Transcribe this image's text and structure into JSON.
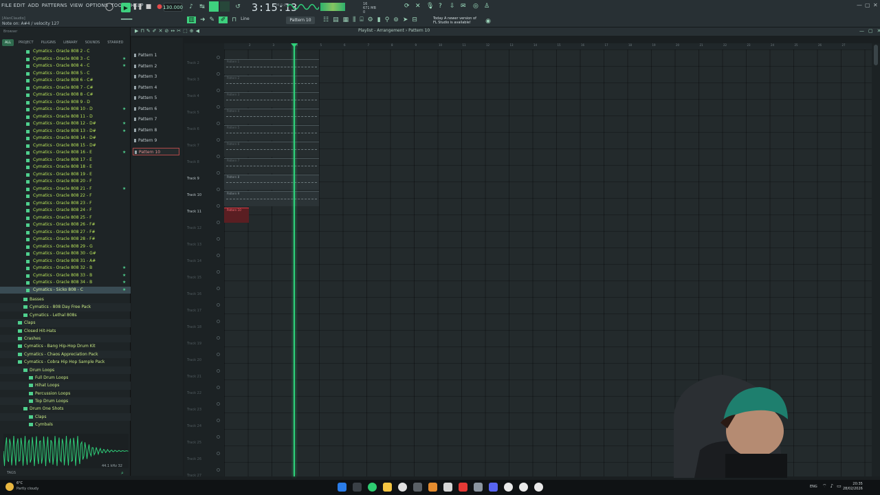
{
  "menu": [
    "FILE EDIT",
    "ADD",
    "PATTERNS",
    "VIEW",
    "OPTIONS",
    "TOOLS",
    "HELP"
  ],
  "hint": "[AlanClaudio]",
  "hint_line": "Note on: A#4 / velocity 127",
  "tempo": "130.000",
  "time": "3:15:13",
  "time_sub": "M:S:CS",
  "cpu_line1": "16",
  "cpu_line2": "671 MB",
  "cpu_line3": "0",
  "pattern_selector": "Pattern 10",
  "news_line1": "Today  A newer version of",
  "news_line2": "FL Studio is available!",
  "snap_mode": "Line",
  "playlist_title": "Playlist - Arrangement › Pattern 10",
  "browser": {
    "title": "Browser",
    "tabs": [
      "ALL",
      "PROJECT",
      "PLUGINS",
      "LIBRARY",
      "SOUNDS",
      "STARRED"
    ],
    "files": [
      {
        "name": "Cymatics - Oracle 808 2 - C",
        "star": false
      },
      {
        "name": "Cymatics - Oracle 808 3 - C",
        "star": true
      },
      {
        "name": "Cymatics - Oracle 808 4 - C",
        "star": true
      },
      {
        "name": "Cymatics - Oracle 808 5 - C",
        "star": false
      },
      {
        "name": "Cymatics - Oracle 808 6 - C#",
        "star": false
      },
      {
        "name": "Cymatics - Oracle 808 7 - C#",
        "star": false
      },
      {
        "name": "Cymatics - Oracle 808 8 - C#",
        "star": false
      },
      {
        "name": "Cymatics - Oracle 808 9 - D",
        "star": false
      },
      {
        "name": "Cymatics - Oracle 808 10 - D",
        "star": true
      },
      {
        "name": "Cymatics - Oracle 808 11 - D",
        "star": false
      },
      {
        "name": "Cymatics - Oracle 808 12 - D#",
        "star": true
      },
      {
        "name": "Cymatics - Oracle 808 13 - D#",
        "star": true
      },
      {
        "name": "Cymatics - Oracle 808 14 - D#",
        "star": false
      },
      {
        "name": "Cymatics - Oracle 808 15 - D#",
        "star": false
      },
      {
        "name": "Cymatics - Oracle 808 16 - E",
        "star": true
      },
      {
        "name": "Cymatics - Oracle 808 17 - E",
        "star": false
      },
      {
        "name": "Cymatics - Oracle 808 18 - E",
        "star": false
      },
      {
        "name": "Cymatics - Oracle 808 19 - E",
        "star": false
      },
      {
        "name": "Cymatics - Oracle 808 20 - F",
        "star": false
      },
      {
        "name": "Cymatics - Oracle 808 21 - F",
        "star": true
      },
      {
        "name": "Cymatics - Oracle 808 22 - F",
        "star": false
      },
      {
        "name": "Cymatics - Oracle 808 23 - F",
        "star": false
      },
      {
        "name": "Cymatics - Oracle 808 24 - F",
        "star": false
      },
      {
        "name": "Cymatics - Oracle 808 25 - F",
        "star": false
      },
      {
        "name": "Cymatics - Oracle 808 26 - F#",
        "star": false
      },
      {
        "name": "Cymatics - Oracle 808 27 - F#",
        "star": false
      },
      {
        "name": "Cymatics - Oracle 808 28 - F#",
        "star": false
      },
      {
        "name": "Cymatics - Oracle 808 29 - G",
        "star": false
      },
      {
        "name": "Cymatics - Oracle 808 30 - G#",
        "star": false
      },
      {
        "name": "Cymatics - Oracle 808 31 - A#",
        "star": false
      },
      {
        "name": "Cymatics - Oracle 808 32 - B",
        "star": true
      },
      {
        "name": "Cymatics - Oracle 808 33 - B",
        "star": true
      },
      {
        "name": "Cymatics - Oracle 808 34 - B",
        "star": true
      }
    ],
    "selected_file": "Cymatics - Sicko 808 - C",
    "folders": [
      {
        "name": "Basses",
        "level": 2
      },
      {
        "name": "Cymatics - 808 Day Free Pack",
        "level": 2
      },
      {
        "name": "Cymatics - Lethal 808s",
        "level": 2
      },
      {
        "name": "Claps",
        "level": 1
      },
      {
        "name": "Closed Hit-Hats",
        "level": 1
      },
      {
        "name": "Crashes",
        "level": 1
      },
      {
        "name": "Cymatics - Bang Hip-Hop Drum Kit",
        "level": 1
      },
      {
        "name": "Cymatics - Chaos Appreciation Pack",
        "level": 1
      },
      {
        "name": "Cymatics - Cobra Hip Hop Sample Pack",
        "level": 1
      },
      {
        "name": "Drum Loops",
        "level": 2
      },
      {
        "name": "Full Drum Loops",
        "level": 3
      },
      {
        "name": "Hihat Loops",
        "level": 3
      },
      {
        "name": "Percussion Loops",
        "level": 3
      },
      {
        "name": "Top Drum Loops",
        "level": 3
      },
      {
        "name": "Drum One Shots",
        "level": 2
      },
      {
        "name": "Claps",
        "level": 3
      },
      {
        "name": "Cymbals",
        "level": 3
      }
    ],
    "wave_info": "44.1 kHz 32",
    "tags_label": "TAGS"
  },
  "patterns": [
    "Pattern 1",
    "Pattern 2",
    "Pattern 3",
    "Pattern 4",
    "Pattern 5",
    "Pattern 6",
    "Pattern 7",
    "Pattern 8",
    "Pattern 9",
    "Pattern 10"
  ],
  "active_pattern": "Pattern 10",
  "tracks": [
    "Track 2",
    "Track 3",
    "Track 4",
    "Track 5",
    "Track 6",
    "Track 7",
    "Track 8",
    "Track 9",
    "Track 10",
    "Track 11",
    "Track 12",
    "Track 13",
    "Track 14",
    "Track 15",
    "Track 16",
    "Track 17",
    "Track 18",
    "Track 19",
    "Track 20",
    "Track 21",
    "Track 22",
    "Track 23",
    "Track 24",
    "Track 25",
    "Track 26",
    "Track 27"
  ],
  "ruler": [
    "2",
    "3",
    "4",
    "5",
    "6",
    "7",
    "8",
    "9",
    "10",
    "11",
    "12",
    "13",
    "14",
    "15",
    "16",
    "17",
    "18",
    "19",
    "20",
    "21",
    "22",
    "23",
    "24",
    "25",
    "26",
    "27"
  ],
  "clips": [
    "Pattern 1",
    "Pattern 2",
    "Pattern 3",
    "Pattern 4",
    "Pattern 5",
    "Pattern 6",
    "Pattern 7",
    "Pattern 8",
    "Pattern 9",
    "Pattern 10"
  ],
  "taskbar": {
    "temp": "6°C",
    "condition": "Partly cloudy",
    "lang": "ENG",
    "time": "20:35",
    "date": "28/02/2026"
  },
  "colors": {
    "accent": "#2fd17a",
    "active_clip": "#e03a44",
    "file_text": "#b9e55a"
  }
}
